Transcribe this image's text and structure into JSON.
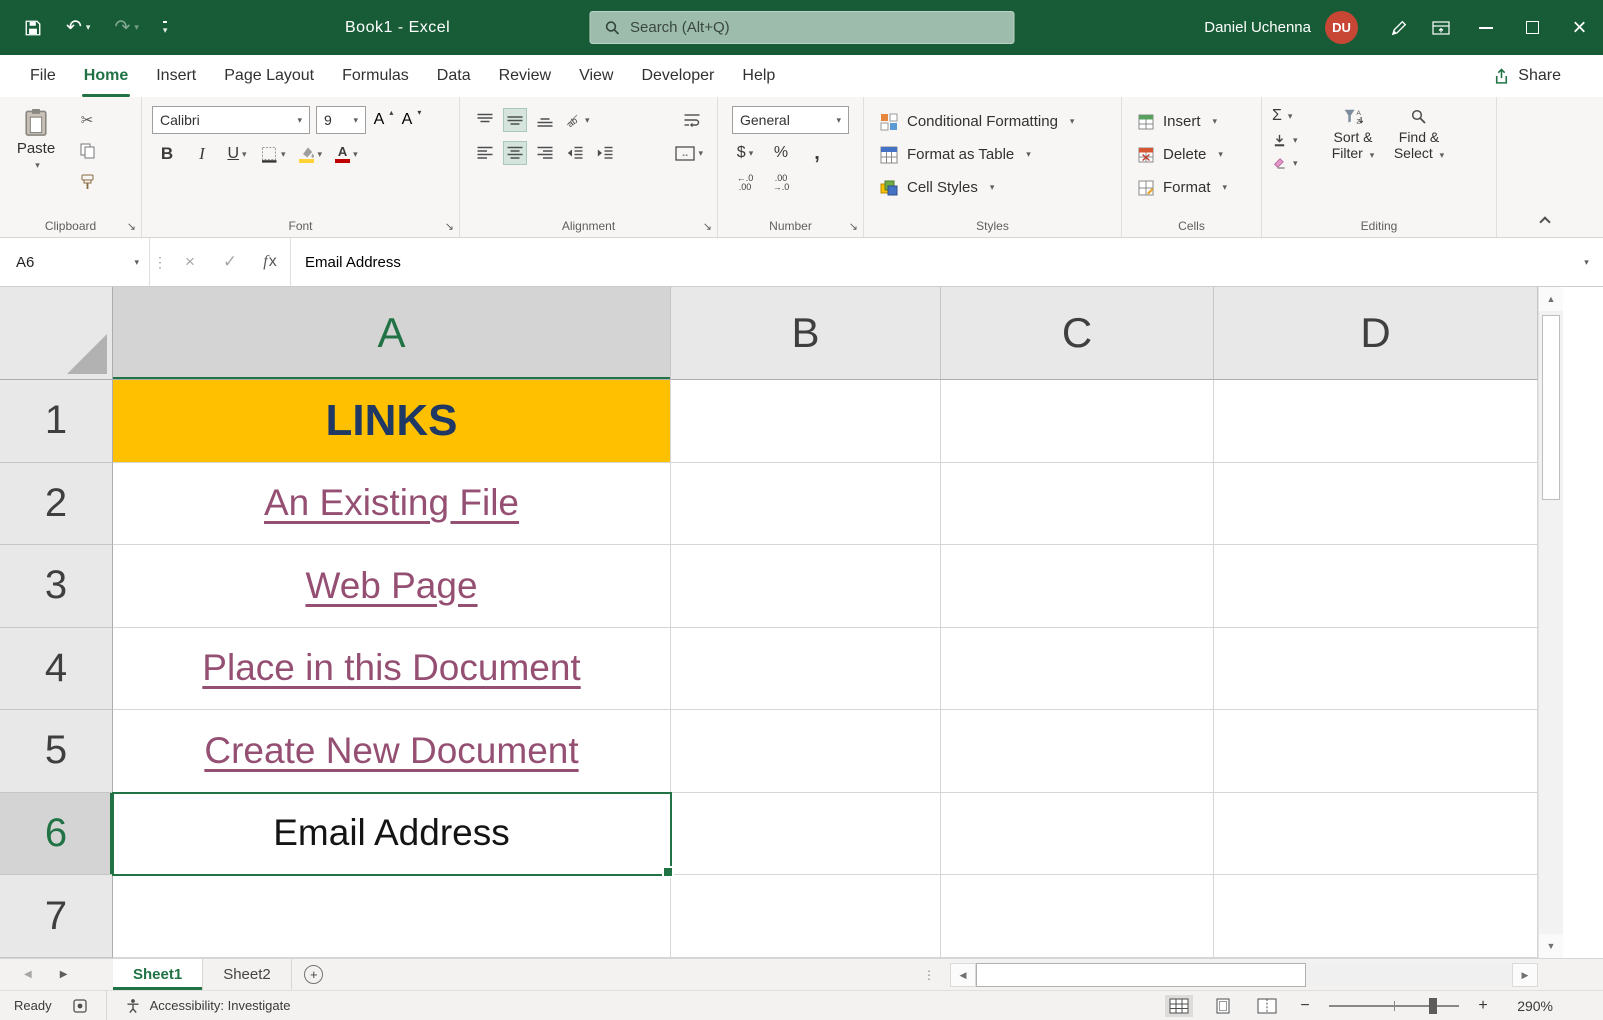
{
  "colors": {
    "titlebar": "#185C37",
    "accent": "#217346",
    "search-bg": "#9DBCAC",
    "avatar-bg": "#C74634",
    "links-fill": "#FFC000",
    "links-text": "#1F3864",
    "hyperlink": "#954F72"
  },
  "title_bar": {
    "title": "Book1 - Excel",
    "search_placeholder": "Search (Alt+Q)",
    "user_name": "Daniel Uchenna",
    "user_initials": "DU"
  },
  "menu": {
    "tabs": [
      "File",
      "Home",
      "Insert",
      "Page Layout",
      "Formulas",
      "Data",
      "Review",
      "View",
      "Developer",
      "Help"
    ],
    "share_label": "Share"
  },
  "ribbon": {
    "clipboard": {
      "label": "Clipboard",
      "paste": "Paste"
    },
    "font": {
      "label": "Font",
      "font_name": "Calibri",
      "font_size": "9"
    },
    "alignment": {
      "label": "Alignment"
    },
    "number": {
      "label": "Number",
      "format": "General"
    },
    "styles": {
      "label": "Styles",
      "conditional_formatting": "Conditional Formatting",
      "format_as_table": "Format as Table",
      "cell_styles": "Cell Styles"
    },
    "cells": {
      "label": "Cells",
      "insert": "Insert",
      "delete": "Delete",
      "format": "Format"
    },
    "editing": {
      "label": "Editing",
      "sort_filter": "Sort & Filter",
      "find_select": "Find & Select"
    }
  },
  "formula_bar": {
    "name_box": "A6",
    "content": "Email Address"
  },
  "grid": {
    "col_headers": [
      "A",
      "B",
      "C",
      "D"
    ],
    "rows": [
      {
        "num": "1",
        "a": "LINKS"
      },
      {
        "num": "2",
        "a": "An Existing File"
      },
      {
        "num": "3",
        "a": "Web Page"
      },
      {
        "num": "4",
        "a": "Place in this Document"
      },
      {
        "num": "5",
        "a": "Create New Document"
      },
      {
        "num": "6",
        "a": "Email Address"
      },
      {
        "num": "7",
        "a": ""
      }
    ]
  },
  "sheet_bar": {
    "tabs": [
      "Sheet1",
      "Sheet2"
    ]
  },
  "status_bar": {
    "ready": "Ready",
    "accessibility": "Accessibility: Investigate",
    "zoom": "290%"
  }
}
